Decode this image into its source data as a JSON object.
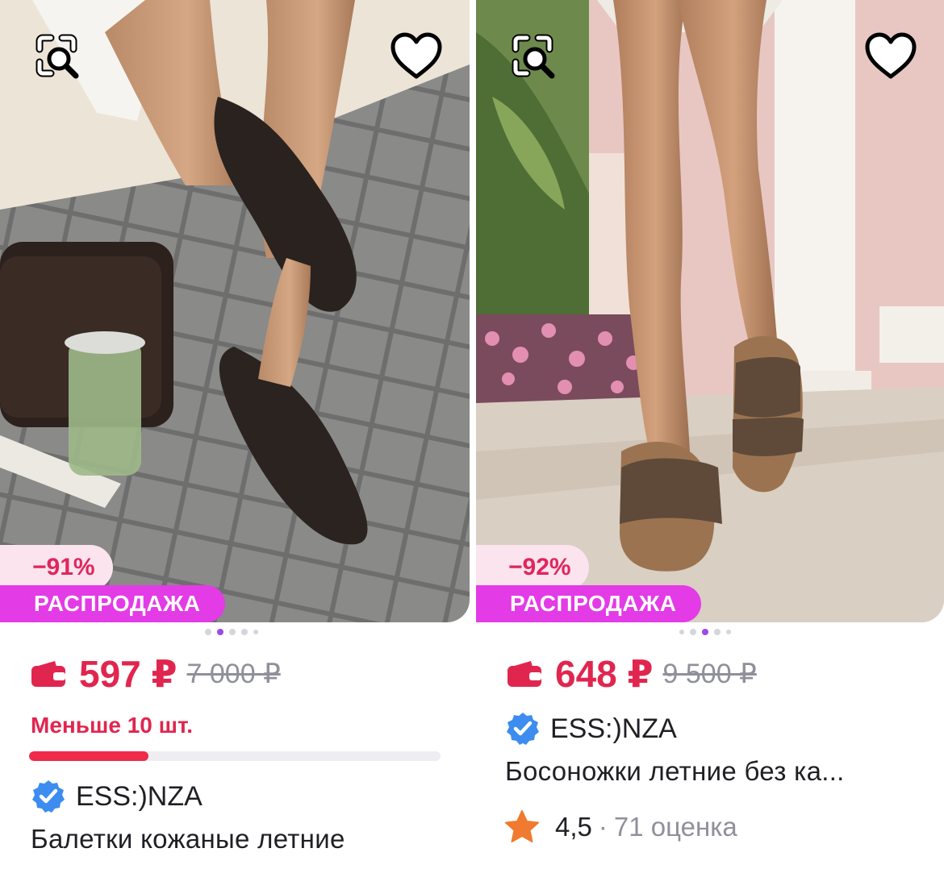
{
  "products": [
    {
      "discount": "−91%",
      "sale_label": "РАСПРОДАЖА",
      "price": "597 ₽",
      "old_price": "7 000 ₽",
      "stock_text": "Меньше 10 шт.",
      "stock_level_percent": 29,
      "brand": "ESS:)NZA",
      "title": "Балетки кожаные летние",
      "gallery": {
        "count": 5,
        "active_index": 1
      },
      "icons": {
        "similar": "search-similar-icon",
        "favorite": "heart-icon",
        "price": "wallet-icon",
        "brand": "verified-icon"
      }
    },
    {
      "discount": "−92%",
      "sale_label": "РАСПРОДАЖА",
      "price": "648 ₽",
      "old_price": "9 500 ₽",
      "brand": "ESS:)NZA",
      "title": "Босоножки летние без ка...",
      "rating": "4,5",
      "reviews": "71 оценка",
      "gallery": {
        "count": 5,
        "active_index": 2
      },
      "icons": {
        "similar": "search-similar-icon",
        "favorite": "heart-icon",
        "price": "wallet-icon",
        "brand": "verified-icon",
        "rating": "star-icon"
      }
    }
  ],
  "colors": {
    "price": "#e0264f",
    "sale_badge": "#e33be6",
    "discount_bg": "#fbe4ee",
    "verified": "#3d8cf0",
    "star": "#f07a2f",
    "dot_active": "#9c49e8"
  }
}
